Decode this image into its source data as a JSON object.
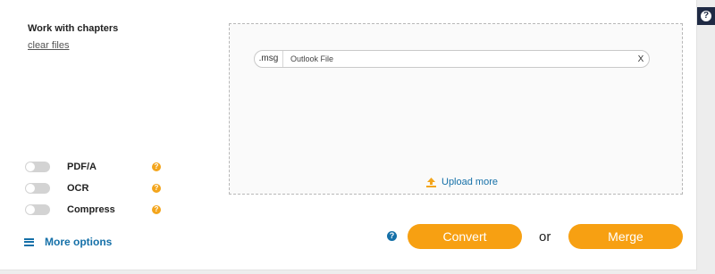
{
  "help_corner": {
    "icon": "question-icon",
    "glyph": "?"
  },
  "sidebar": {
    "title": "Work with chapters",
    "clear_files": "clear files",
    "options": [
      {
        "label": "PDF/A",
        "enabled": false,
        "help_glyph": "?"
      },
      {
        "label": "OCR",
        "enabled": false,
        "help_glyph": "?"
      },
      {
        "label": "Compress",
        "enabled": false,
        "help_glyph": "?"
      }
    ],
    "more_options": "More options"
  },
  "dropzone": {
    "file": {
      "extension": ".msg",
      "name": "Outlook File",
      "remove": "X"
    },
    "upload_more": "Upload more"
  },
  "actions": {
    "help_glyph": "?",
    "convert": "Convert",
    "or": "or",
    "merge": "Merge"
  },
  "colors": {
    "accent_orange": "#f7a012",
    "link_blue": "#1570a8",
    "help_orange": "#f3a51c",
    "toggle_off": "#d3d3d3"
  }
}
